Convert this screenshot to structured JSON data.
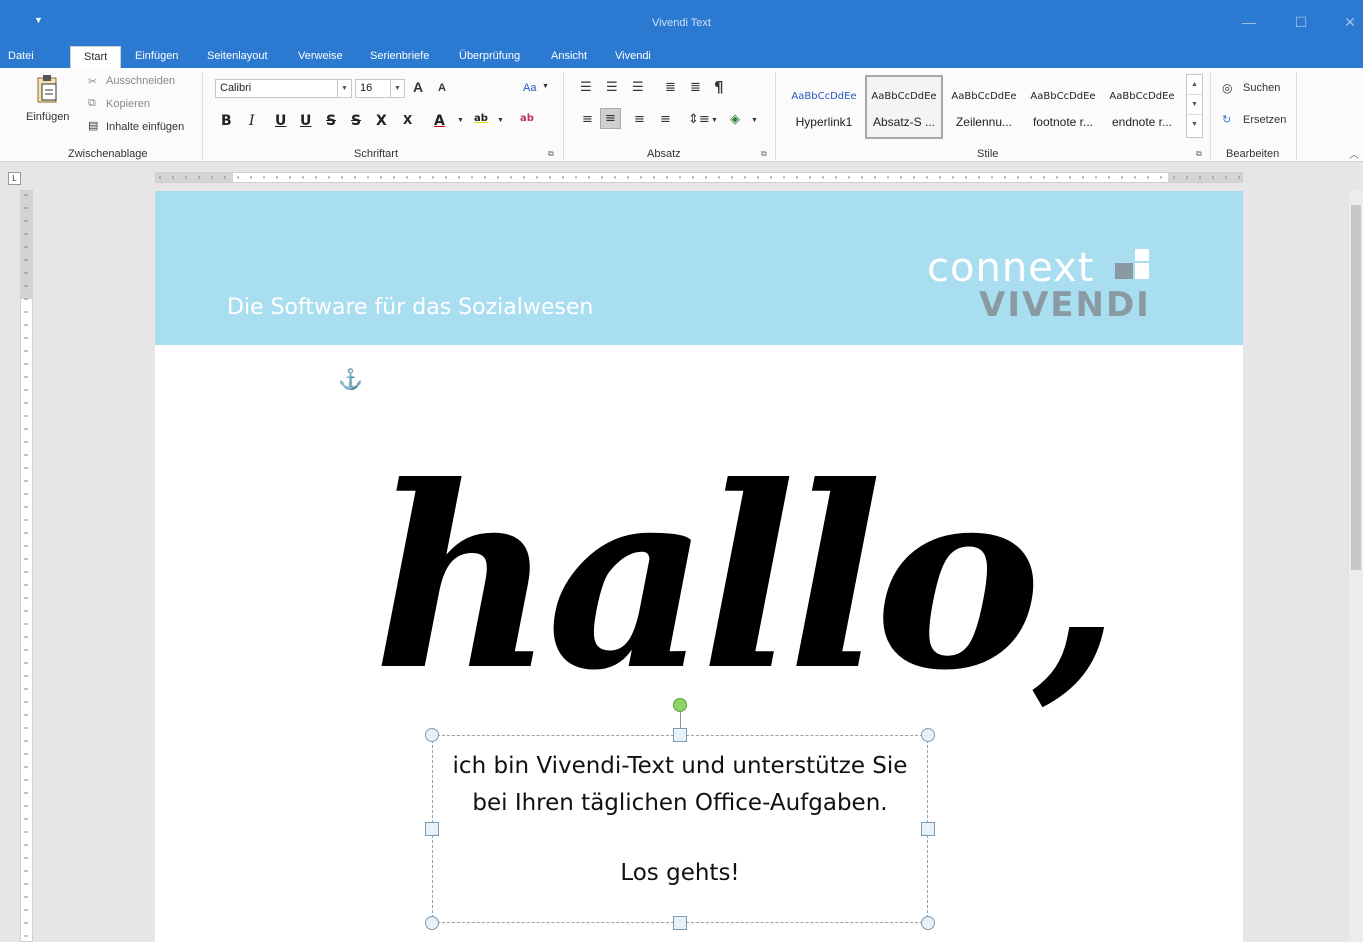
{
  "window": {
    "title": "Vivendi Text",
    "qat_icon": "dropdown-arrow-icon"
  },
  "tabs": [
    "Datei",
    "Start",
    "Einfügen",
    "Seitenlayout",
    "Verweise",
    "Serienbriefe",
    "Überprüfung",
    "Ansicht",
    "Vivendi"
  ],
  "clipboard": {
    "paste": "Einfügen",
    "cut": "Ausschneiden",
    "copy": "Kopieren",
    "paste_special": "Inhalte einfügen",
    "label": "Zwischenablage"
  },
  "font": {
    "name": "Calibri",
    "size": "16",
    "label": "Schriftart",
    "grow": "A",
    "shrink": "A",
    "case": "Aa"
  },
  "format_buttons": [
    "B",
    "I",
    "U",
    "U",
    "S",
    "S",
    "X",
    "X",
    "A",
    "ab",
    "ab"
  ],
  "paragraph": {
    "label": "Absatz",
    "pilcrow": "¶"
  },
  "styles": {
    "label": "Stile",
    "items": [
      {
        "sample": "AaBbCcDdEe",
        "name": "Hyperlink1"
      },
      {
        "sample": "AaBbCcDdEe",
        "name": "Absatz-S ..."
      },
      {
        "sample": "AaBbCcDdEe",
        "name": "Zeilennu..."
      },
      {
        "sample": "AaBbCcDdEe",
        "name": "footnote r..."
      },
      {
        "sample": "AaBbCcDdEe",
        "name": "endnote r..."
      }
    ]
  },
  "editing": {
    "find": "Suchen",
    "replace": "Ersetzen",
    "label": "Bearbeiten"
  },
  "ruler": {
    "tab_selector": "L"
  },
  "document": {
    "banner_tagline": "Die Software für das Sozialwesen",
    "logo_top": "connext",
    "logo_bottom": "VIVENDI",
    "hallo": "hallo,",
    "textbox_line1": "ich bin Vivendi-Text und unterstütze Sie",
    "textbox_line2": "bei Ihren täglichen Office-Aufgaben.",
    "textbox_line3": "Los gehts!"
  },
  "colors": {
    "accent": "#2b79d0",
    "banner": "#a9def0",
    "hyperlink_style": "#2a55c0"
  }
}
